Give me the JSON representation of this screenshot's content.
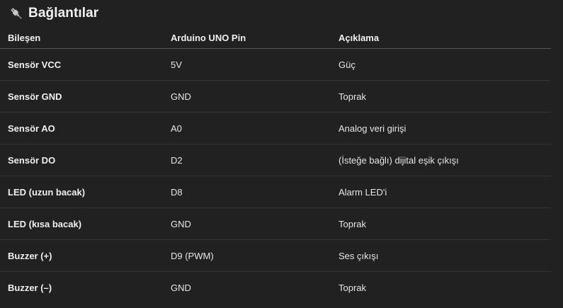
{
  "section": {
    "title": "Bağlantılar",
    "icon": "plug-icon"
  },
  "table": {
    "headers": [
      "Bileşen",
      "Arduino UNO Pin",
      "Açıklama"
    ],
    "rows": [
      [
        "Sensör VCC",
        "5V",
        "Güç"
      ],
      [
        "Sensör GND",
        "GND",
        "Toprak"
      ],
      [
        "Sensör AO",
        "A0",
        "Analog veri girişi"
      ],
      [
        "Sensör DO",
        "D2",
        "(İsteğe bağlı) dijital eşik çıkışı"
      ],
      [
        "LED (uzun bacak)",
        "D8",
        "Alarm LED'i"
      ],
      [
        "LED (kısa bacak)",
        "GND",
        "Toprak"
      ],
      [
        "Buzzer (+)",
        "D9 (PWM)",
        "Ses çıkışı"
      ],
      [
        "Buzzer (–)",
        "GND",
        "Toprak"
      ]
    ]
  }
}
